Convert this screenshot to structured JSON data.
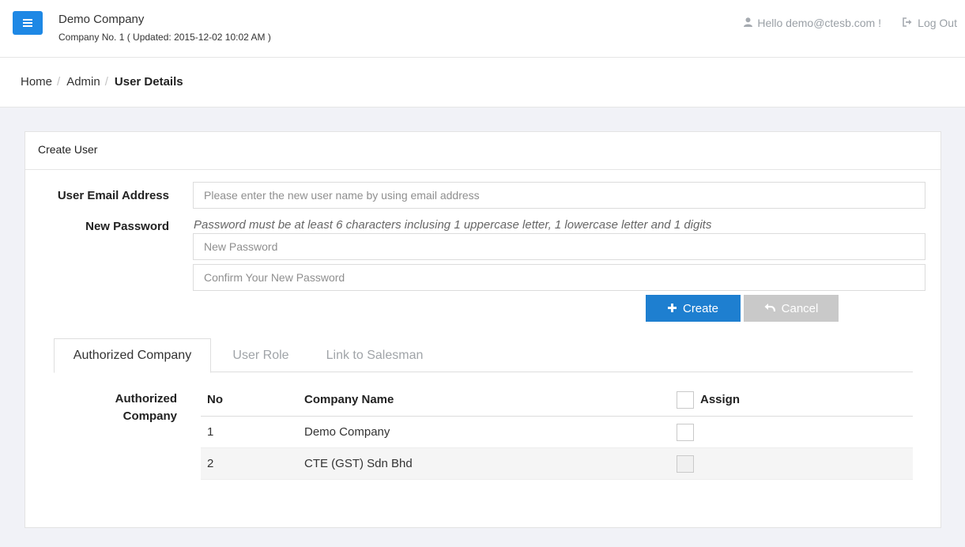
{
  "header": {
    "company_name": "Demo Company",
    "company_sub": "Company No. 1 ( Updated: 2015-12-02 10:02 AM )",
    "greeting": "Hello demo@ctesb.com !",
    "logout_label": "Log Out"
  },
  "breadcrumb": {
    "home": "Home",
    "admin": "Admin",
    "current": "User Details"
  },
  "form": {
    "panel_title": "Create User",
    "email_label": "User Email Address",
    "email_placeholder": "Please enter the new user name by using email address",
    "email_value": "",
    "password_label": "New Password",
    "password_hint": "Password must be at least 6 characters inclusing 1 uppercase letter, 1 lowercase letter and 1 digits",
    "new_password_placeholder": "New Password",
    "new_password_value": "",
    "confirm_password_placeholder": "Confirm Your New Password",
    "confirm_password_value": "",
    "create_label": "Create",
    "cancel_label": "Cancel"
  },
  "tabs": [
    {
      "label": "Authorized Company",
      "active": true
    },
    {
      "label": "User Role",
      "active": false
    },
    {
      "label": "Link to Salesman",
      "active": false
    }
  ],
  "authorized": {
    "section_label_line1": "Authorized",
    "section_label_line2": "Company",
    "columns": {
      "no": "No",
      "company": "Company Name",
      "assign": "Assign"
    },
    "rows": [
      {
        "no": "1",
        "company": "Demo Company",
        "assigned": false
      },
      {
        "no": "2",
        "company": "CTE (GST) Sdn Bhd",
        "assigned": false
      }
    ]
  },
  "colors": {
    "accent": "#1e88e5",
    "create_button": "#1e7fd0",
    "cancel_button": "#c9c9c9"
  },
  "icons": {
    "menu": "hamburger-icon",
    "user": "user-icon",
    "logout": "sign-out-icon",
    "create": "plus-icon",
    "cancel": "undo-arrow-icon"
  }
}
